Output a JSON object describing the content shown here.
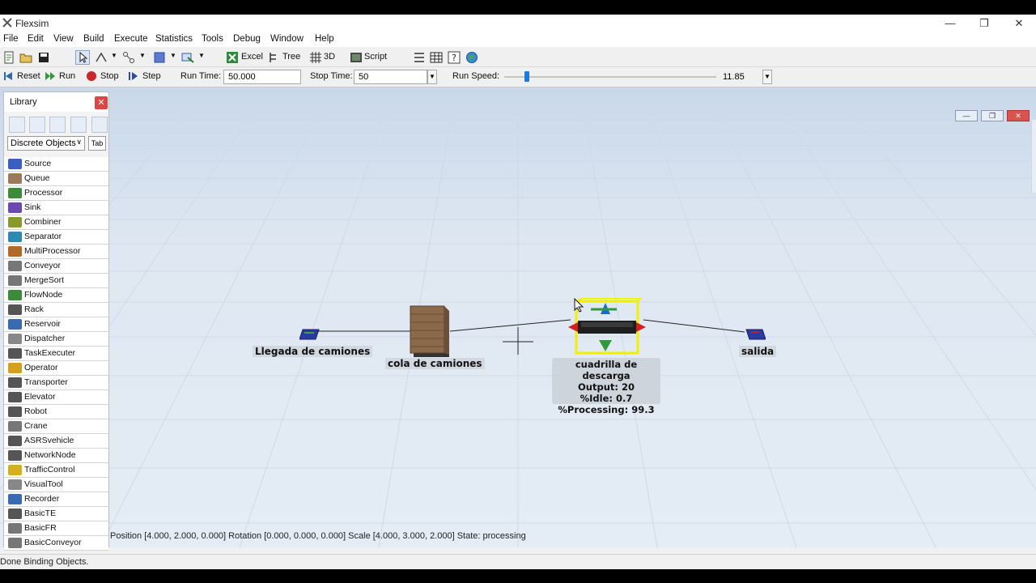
{
  "window": {
    "title": "Flexsim"
  },
  "menu": [
    "File",
    "Edit",
    "View",
    "Build",
    "Execute",
    "Statistics",
    "Tools",
    "Debug",
    "Window",
    "Help"
  ],
  "toolbar": {
    "excel_label": "Excel",
    "tree_label": "Tree",
    "view3d_label": "3D",
    "script_label": "Script"
  },
  "runbar": {
    "reset_label": "Reset",
    "run_label": "Run",
    "stop_label": "Stop",
    "step_label": "Step",
    "run_time_label": "Run Time:",
    "run_time_value": "50.000",
    "stop_time_label": "Stop Time:",
    "stop_time_value": "50",
    "run_speed_label": "Run Speed:",
    "run_speed_value": "11.85"
  },
  "library": {
    "title": "Library",
    "category": "Discrete Objects",
    "tab_label": "Tab",
    "items": [
      "Source",
      "Queue",
      "Processor",
      "Sink",
      "Combiner",
      "Separator",
      "MultiProcessor",
      "Conveyor",
      "MergeSort",
      "FlowNode",
      "Rack",
      "Reservoir",
      "Dispatcher",
      "TaskExecuter",
      "Operator",
      "Transporter",
      "Elevator",
      "Robot",
      "Crane",
      "ASRSvehicle",
      "NetworkNode",
      "TrafficControl",
      "VisualTool",
      "Recorder",
      "BasicTE",
      "BasicFR",
      "BasicConveyor"
    ],
    "icon_colors": [
      "#3a5fc0",
      "#9a7a5a",
      "#3c8a3c",
      "#6a4ab0",
      "#8a9a2a",
      "#2a8ab0",
      "#b06a2a",
      "#777777",
      "#777777",
      "#3c8a3c",
      "#555555",
      "#3a6ab0",
      "#888888",
      "#555555",
      "#d4a020",
      "#555555",
      "#555555",
      "#555555",
      "#777777",
      "#555555",
      "#555555",
      "#d4b020",
      "#888888",
      "#3a6ab0",
      "#555555",
      "#777777",
      "#777777"
    ]
  },
  "model": {
    "source_label": "Llegada de camiones",
    "queue_label": "cola de camiones",
    "processor_label": "cuadrilla de descarga",
    "processor_stats": [
      "Output: 20",
      "%Idle:  0.7",
      "%Processing: 99.3"
    ],
    "sink_label": "salida"
  },
  "view_status": "Position [4.000, 2.000, 0.000]  Rotation [0.000, 0.000, 0.000]  Scale [4.000, 3.000, 2.000]  State: processing",
  "statusbar": "Done Binding Objects.",
  "colors": {
    "viewport_bg": "#dfe8f3",
    "selection": "#ffff00",
    "close_red": "#e04343"
  }
}
